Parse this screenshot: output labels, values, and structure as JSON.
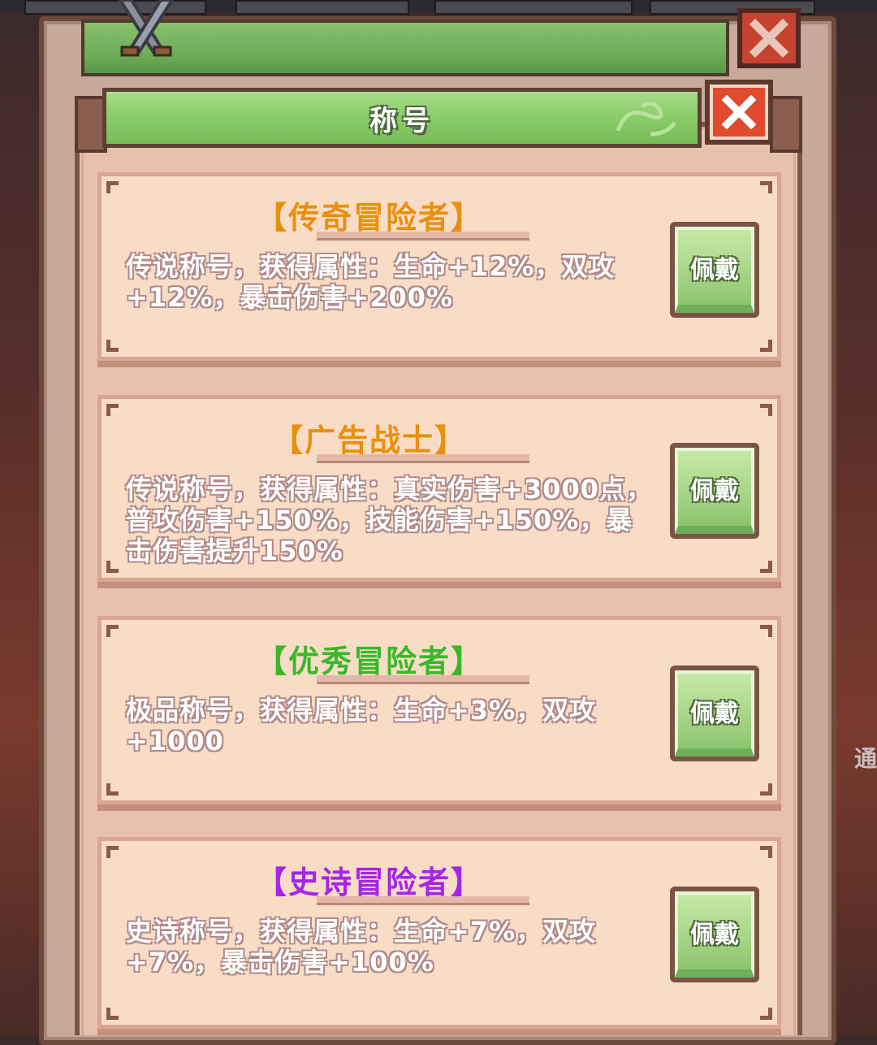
{
  "dialog": {
    "title": "称号"
  },
  "titles": [
    {
      "name": "【传奇冒险者】",
      "color": "#e8900e",
      "description": "传说称号，获得属性：生命+12%，双攻+12%，暴击伤害+200%",
      "button_label": "佩戴"
    },
    {
      "name": "【广告战士】",
      "color": "#e8900e",
      "description": "传说称号，获得属性：真实伤害+3000点，普攻伤害+150%，技能伤害+150%，暴击伤害提升150%",
      "button_label": "佩戴"
    },
    {
      "name": "【优秀冒险者】",
      "color": "#3ab829",
      "description": "极品称号，获得属性：生命+3%，双攻+1000",
      "button_label": "佩戴"
    },
    {
      "name": "【史诗冒险者】",
      "color": "#a426e8",
      "description": "史诗称号，获得属性：生命+7%，双攻+7%，暴击伤害+100%",
      "button_label": "佩戴"
    }
  ],
  "background_peek_text": "通"
}
